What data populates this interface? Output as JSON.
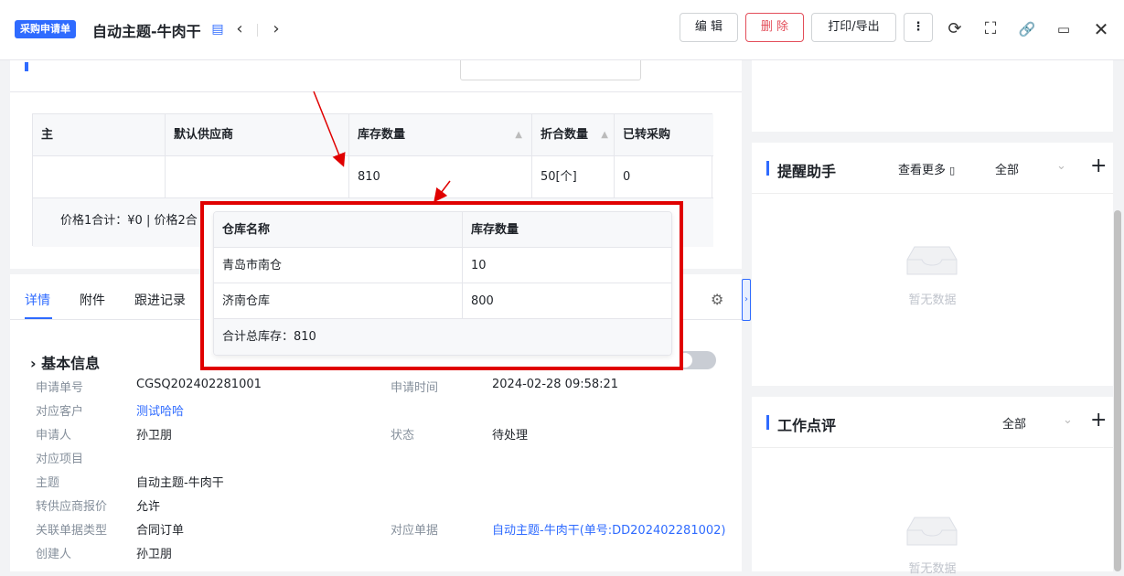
{
  "header": {
    "badge": "采购申请单",
    "title": "自动主题-牛肉干",
    "edit_label": "编 辑",
    "delete_label": "删 除",
    "print_label": "打印/导出"
  },
  "product_table": {
    "columns": [
      "主",
      "默认供应商",
      "库存数量",
      "折合数量",
      "已转采购"
    ],
    "row": [
      "",
      "",
      "810",
      "50[个]",
      "0"
    ],
    "summary": "价格1合计：¥0 |   价格2合"
  },
  "tabs": [
    "详情",
    "附件",
    "跟进记录"
  ],
  "basic_info": {
    "title": "基本信息",
    "fields": [
      {
        "label": "申请单号",
        "value": "CGSQ202402281001"
      },
      {
        "label": "申请时间",
        "value": "2024-02-28 09:58:21"
      },
      {
        "label": "对应客户",
        "value": "测试哈哈"
      },
      {
        "label": "申请人",
        "value": "孙卫朋"
      },
      {
        "label": "状态",
        "value": "待处理"
      },
      {
        "label": "对应项目",
        "value": ""
      },
      {
        "label": "主题",
        "value": "自动主题-牛肉干"
      },
      {
        "label": "转供应商报价",
        "value": "允许"
      },
      {
        "label": "关联单据类型",
        "value": "合同订单"
      },
      {
        "label": "对应单据",
        "value": "自动主题-牛肉干(单号:DD202402281002)"
      },
      {
        "label": "创建人",
        "value": "孙卫朋"
      }
    ]
  },
  "reminder": {
    "title": "提醒助手",
    "more": "查看更多",
    "filter": "全部",
    "empty": "暂无数据"
  },
  "review": {
    "title": "工作点评",
    "filter": "全部",
    "empty": "暂无数据"
  },
  "stock_popup": {
    "col_name": "仓库名称",
    "col_qty": "库存数量",
    "rows": [
      {
        "name": "青岛市南仓",
        "qty": "10"
      },
      {
        "name": "济南仓库",
        "qty": "800"
      }
    ],
    "total": "合计总库存：810"
  },
  "colors": {
    "accent": "#2f6bff",
    "danger": "#e34d59",
    "highlight": "#e00000"
  }
}
